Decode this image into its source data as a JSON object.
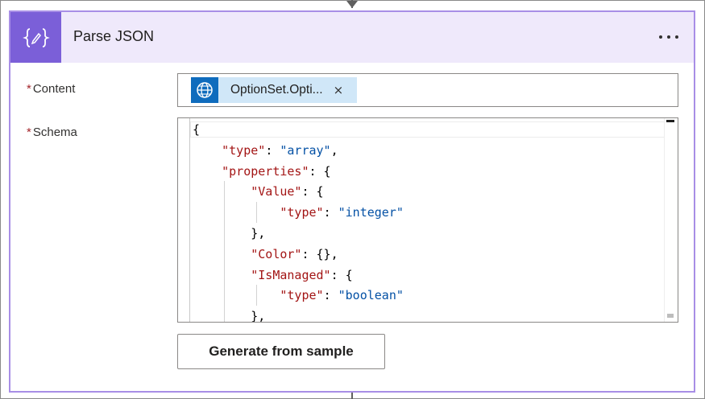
{
  "action": {
    "title": "Parse JSON",
    "icon": "json-curly-braces-icon",
    "header_color": "#efe9fb",
    "accent_color": "#7b5fd8"
  },
  "content": {
    "label": "Content",
    "required_marker": "*",
    "token": {
      "text": "OptionSet.Opti...",
      "icon": "globe-icon",
      "remove": "×"
    }
  },
  "schema": {
    "label": "Schema",
    "required_marker": "*",
    "lines": [
      {
        "parts": [
          {
            "t": "{",
            "c": "p"
          }
        ]
      },
      {
        "parts": [
          {
            "t": "    ",
            "c": "p"
          },
          {
            "t": "\"type\"",
            "c": "k"
          },
          {
            "t": ": ",
            "c": "p"
          },
          {
            "t": "\"array\"",
            "c": "s"
          },
          {
            "t": ",",
            "c": "p"
          }
        ]
      },
      {
        "parts": [
          {
            "t": "    ",
            "c": "p"
          },
          {
            "t": "\"properties\"",
            "c": "k"
          },
          {
            "t": ": {",
            "c": "p"
          }
        ]
      },
      {
        "parts": [
          {
            "t": "        ",
            "c": "p"
          },
          {
            "t": "\"Value\"",
            "c": "k"
          },
          {
            "t": ": {",
            "c": "p"
          }
        ]
      },
      {
        "parts": [
          {
            "t": "            ",
            "c": "p"
          },
          {
            "t": "\"type\"",
            "c": "k"
          },
          {
            "t": ": ",
            "c": "p"
          },
          {
            "t": "\"integer\"",
            "c": "s"
          }
        ]
      },
      {
        "parts": [
          {
            "t": "        },",
            "c": "p"
          }
        ]
      },
      {
        "parts": [
          {
            "t": "        ",
            "c": "p"
          },
          {
            "t": "\"Color\"",
            "c": "k"
          },
          {
            "t": ": {},",
            "c": "p"
          }
        ]
      },
      {
        "parts": [
          {
            "t": "        ",
            "c": "p"
          },
          {
            "t": "\"IsManaged\"",
            "c": "k"
          },
          {
            "t": ": {",
            "c": "p"
          }
        ]
      },
      {
        "parts": [
          {
            "t": "            ",
            "c": "p"
          },
          {
            "t": "\"type\"",
            "c": "k"
          },
          {
            "t": ": ",
            "c": "p"
          },
          {
            "t": "\"boolean\"",
            "c": "s"
          }
        ]
      },
      {
        "parts": [
          {
            "t": "        },",
            "c": "p"
          }
        ]
      }
    ]
  },
  "buttons": {
    "generate_label": "Generate from sample",
    "more_icon": "ellipsis-icon"
  }
}
